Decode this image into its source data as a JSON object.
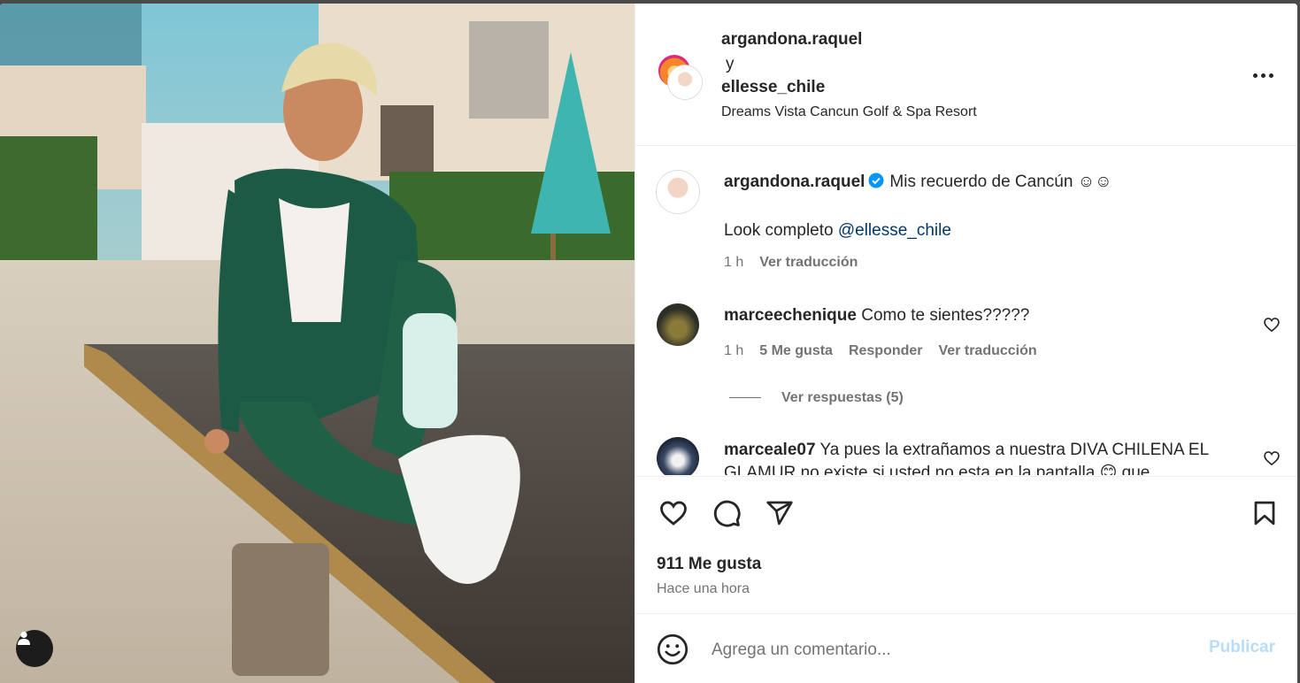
{
  "post": {
    "authors": {
      "primary": "argandona.raquel",
      "connector": "y",
      "collaborator": "ellesse_chile"
    },
    "location": "Dreams Vista Cancun Golf & Spa Resort",
    "caption": {
      "username": "argandona.raquel",
      "text": "Mis recuerdo de Cancún ☺☺",
      "line2_prefix": "Look completo ",
      "mention": "@ellesse_chile",
      "time": "1 h",
      "translate": "Ver traducción"
    }
  },
  "comments": [
    {
      "username": "marceechenique",
      "text": "Como te sientes?????",
      "time": "1 h",
      "likes": "5 Me gusta",
      "reply": "Responder",
      "translate": "Ver traducción",
      "replies": "Ver respuestas (5)"
    },
    {
      "username": "marceale07",
      "text": "Ya pues la extrañamos a nuestra DIVA CHILENA EL",
      "text_line2": "GLAMUR no existe si usted no esta en la pantalla 😊 que"
    }
  ],
  "stats": {
    "likes": "911 Me gusta",
    "posted": "Hace una hora"
  },
  "composer": {
    "placeholder": "Agrega un comentario...",
    "publish": "Publicar"
  },
  "icons": {
    "more": "more-icon",
    "like": "heart-icon",
    "comment": "comment-icon",
    "share": "send-icon",
    "save": "bookmark-icon",
    "emoji": "emoji-icon",
    "tagged": "user-icon"
  },
  "colors": {
    "link": "#00376b",
    "verified": "#0095f6",
    "publish_disabled": "#b9dcfb",
    "muted": "#737373"
  }
}
